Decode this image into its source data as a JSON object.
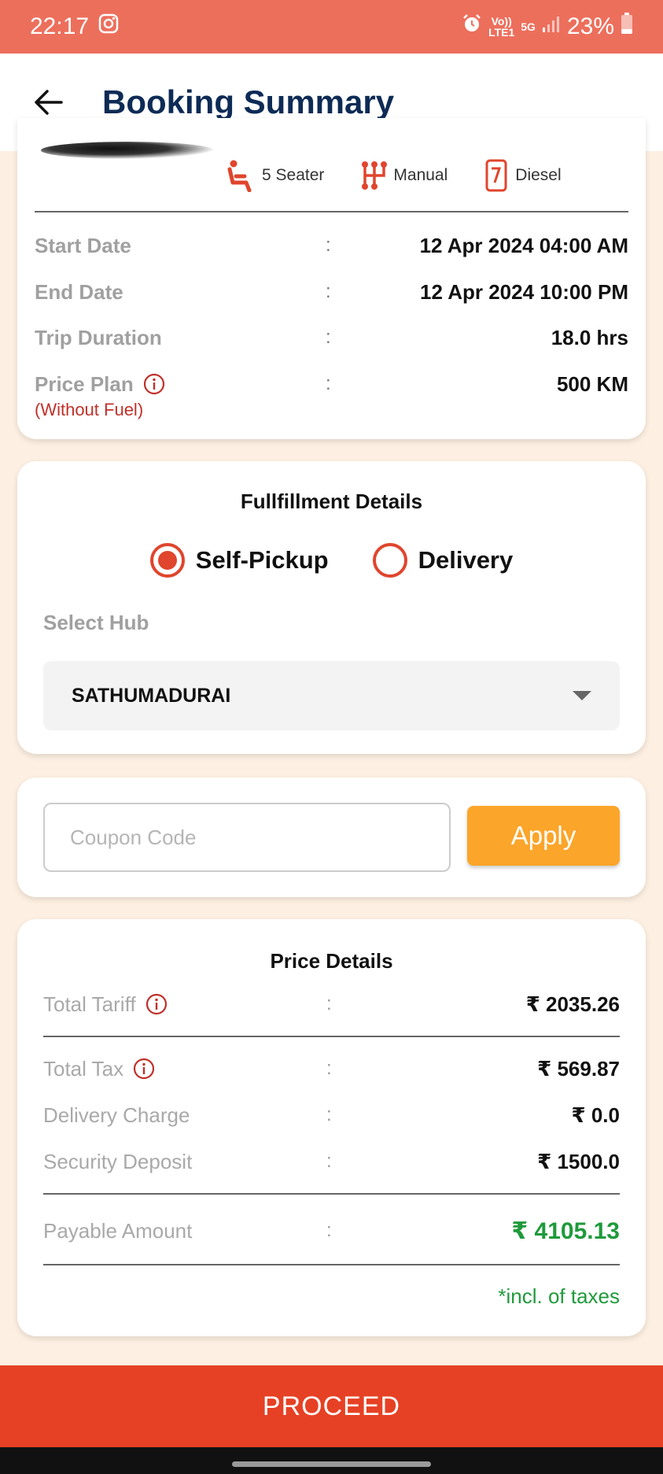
{
  "status_bar": {
    "time": "22:17",
    "network_top": "Vo))",
    "network_bottom": "LTE1",
    "network_5g": "5G",
    "battery": "23%",
    "icons": [
      "instagram-icon",
      "alarm-icon",
      "signal-icon",
      "battery-icon"
    ]
  },
  "header": {
    "title": "Booking Summary",
    "back_icon": "arrow-left-icon"
  },
  "vehicle": {
    "specs": [
      {
        "label": "5 Seater",
        "icon": "seat-icon"
      },
      {
        "label": "Manual",
        "icon": "gearbox-icon"
      },
      {
        "label": "Diesel",
        "icon": "fuel-icon"
      }
    ]
  },
  "trip": {
    "start_label": "Start Date",
    "start_value": "12 Apr 2024 04:00 AM",
    "end_label": "End Date",
    "end_value": "12 Apr 2024 10:00 PM",
    "duration_label": "Trip Duration",
    "duration_value": "18.0 hrs",
    "plan_label": "Price Plan",
    "plan_value": "500 KM",
    "plan_note": "(Without Fuel)",
    "separator": ":"
  },
  "fulfillment": {
    "heading": "Fullfillment Details",
    "options": [
      "Self-Pickup",
      "Delivery"
    ],
    "selected": "Self-Pickup",
    "hub_label": "Select Hub",
    "hub_value": "SATHUMADURAI"
  },
  "coupon": {
    "placeholder": "Coupon Code",
    "value": "",
    "apply_label": "Apply"
  },
  "price": {
    "heading": "Price Details",
    "separator": ":",
    "tariff_label": "Total Tariff",
    "tariff_value": "₹ 2035.26",
    "tax_label": "Total Tax",
    "tax_value": "₹ 569.87",
    "delivery_label": "Delivery Charge",
    "delivery_value": "₹ 0.0",
    "deposit_label": "Security Deposit",
    "deposit_value": "₹ 1500.0",
    "payable_label": "Payable Amount",
    "payable_value": "₹ 4105.13",
    "tax_note": "*incl. of taxes"
  },
  "footer": {
    "proceed_label": "PROCEED"
  },
  "colors": {
    "status_bar": "#EC6F5C",
    "title": "#0D2B55",
    "accent_red": "#E0452D",
    "apply_orange": "#FBA52A",
    "proceed_red": "#E64124",
    "amount_green": "#1F9A3B",
    "background": "#FDF0E2"
  }
}
